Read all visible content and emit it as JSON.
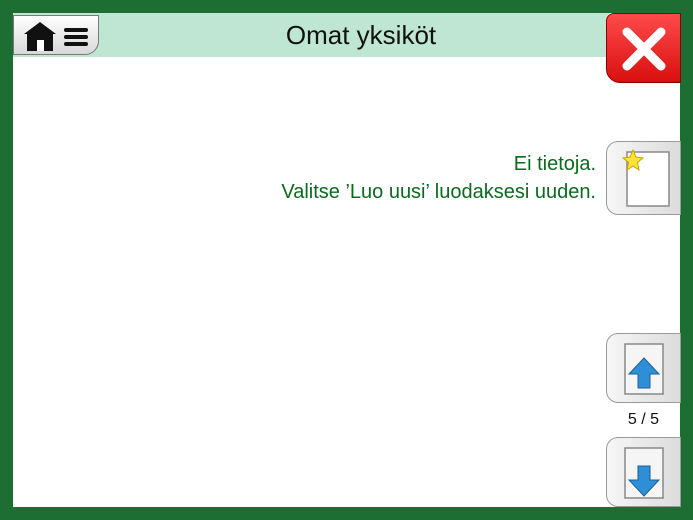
{
  "header": {
    "title": "Omat yksiköt"
  },
  "main": {
    "empty_line1": "Ei tietoja.",
    "empty_line2": "Valitse ’Luo uusi’ luodaksesi uuden."
  },
  "sidebar": {
    "page_counter": "5 / 5"
  },
  "colors": {
    "frame": "#1d6e33",
    "titlebar": "#bfe6d2",
    "message_text": "#0a6b1e",
    "close_button": "#e01f1f",
    "arrow_blue": "#2f8fd6"
  },
  "icons": {
    "home": "home-icon",
    "menu": "menu-icon",
    "close": "close-icon",
    "new": "new-document-icon",
    "up": "page-up-icon",
    "down": "page-down-icon"
  }
}
